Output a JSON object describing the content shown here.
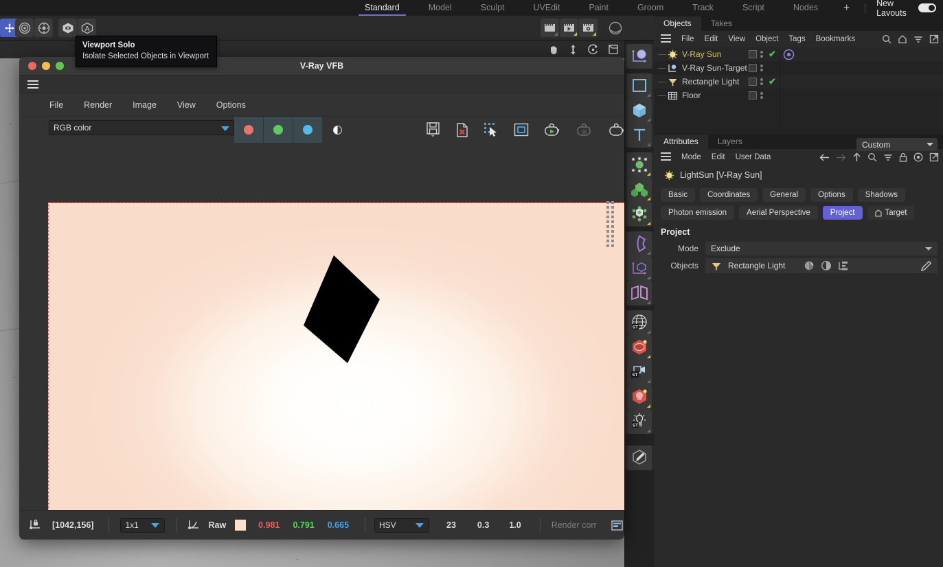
{
  "topbar": {
    "tabs": [
      {
        "label": "Standard",
        "active": true
      },
      {
        "label": "Model",
        "active": false
      },
      {
        "label": "Sculpt",
        "active": false
      },
      {
        "label": "UVEdit",
        "active": false
      },
      {
        "label": "Paint",
        "active": false
      },
      {
        "label": "Groom",
        "active": false
      },
      {
        "label": "Track",
        "active": false
      },
      {
        "label": "Script",
        "active": false
      },
      {
        "label": "Nodes",
        "active": false
      }
    ],
    "plus": "+",
    "new_layouts_label": "New Layouts",
    "toggle_on": true,
    "accent_color": "#6e6ee0"
  },
  "tooltip": {
    "title": "Viewport Solo",
    "body": "Isolate Selected Objects in Viewport"
  },
  "vfb": {
    "window_title": "V-Ray VFB",
    "menus": [
      "File",
      "Render",
      "Image",
      "View",
      "Options"
    ],
    "channel_select": {
      "value": "RGB color",
      "caret_color": "#4aa3dd"
    },
    "channel_buttons": [
      {
        "name": "red-channel",
        "color": "#e8736f"
      },
      {
        "name": "green-channel",
        "color": "#5ecb5e"
      },
      {
        "name": "blue-channel",
        "color": "#55b9ea"
      },
      {
        "name": "alpha-channel",
        "color": "#ffffff"
      }
    ],
    "toolbar_icons": [
      "save-image-icon",
      "remove-image-icon",
      "region-render-icon",
      "frame-stamp-icon",
      "render-start-icon",
      "render-stop-icon",
      "render-last-icon"
    ],
    "status": {
      "pixel_coords": "[1042,156]",
      "zoom_level": "1x1",
      "mode_label": "Raw",
      "swatch_color": "#fbe0cd",
      "r": "0.981",
      "g": "0.791",
      "b": "0.665",
      "r_color": "#e8605a",
      "g_color": "#4ddc5c",
      "b_color": "#4aa3e8",
      "color_space": "HSV",
      "h": "23",
      "s": "0.3",
      "v": "1.0",
      "render_text": "Render corr"
    }
  },
  "objects_panel": {
    "tabs": [
      {
        "label": "Objects",
        "active": true
      },
      {
        "label": "Takes",
        "active": false
      }
    ],
    "menu": [
      "File",
      "Edit",
      "View",
      "Object",
      "Tags",
      "Bookmarks"
    ],
    "menu_icons": [
      "search-icon",
      "home-icon",
      "filter-icon",
      "open-external-icon"
    ],
    "items": [
      {
        "label": "V-Ray Sun",
        "icon": "sun-light-icon",
        "selected": true,
        "has_check": true,
        "has_radio": true
      },
      {
        "label": "V-Ray Sun-Target",
        "icon": "target-null-icon",
        "selected": false,
        "has_check": false,
        "has_radio": false
      },
      {
        "label": "Rectangle Light",
        "icon": "rectangle-light-icon",
        "selected": false,
        "has_check": true,
        "has_radio": false
      },
      {
        "label": "Floor",
        "icon": "floor-plane-icon",
        "selected": false,
        "has_check": false,
        "has_radio": false
      }
    ]
  },
  "attributes_panel": {
    "tabs": [
      {
        "label": "Attributes",
        "active": true
      },
      {
        "label": "Layers",
        "active": false
      }
    ],
    "menu": [
      "Mode",
      "Edit",
      "User Data"
    ],
    "menu_icons": [
      "back-arrow-icon",
      "forward-arrow-icon",
      "up-arrow-icon",
      "search-icon",
      "filter-icon",
      "lock-icon",
      "record-icon",
      "open-external-icon"
    ],
    "object_title": "LightSun [V-Ray Sun]",
    "preset": "Custom",
    "chips_row1": [
      {
        "label": "Basic",
        "active": false
      },
      {
        "label": "Coordinates",
        "active": false
      },
      {
        "label": "General",
        "active": false
      },
      {
        "label": "Options",
        "active": false
      },
      {
        "label": "Shadows",
        "active": false
      }
    ],
    "chips_row2": [
      {
        "label": "Photon emission",
        "active": false
      },
      {
        "label": "Aerial Perspective",
        "active": false
      },
      {
        "label": "Project",
        "active": true
      },
      {
        "label": "Target",
        "active": false,
        "icon": "target-tag-icon"
      }
    ],
    "section_title": "Project",
    "mode_label": "Mode",
    "mode_value": "Exclude",
    "objects_label": "Objects",
    "objects_value": "Rectangle Light",
    "objects_icon": "rectangle-light-icon",
    "row_icons": [
      "shadow-toggle-icon",
      "contrast-toggle-icon",
      "hierarchy-toggle-icon"
    ],
    "edit_icon": "pencil-icon",
    "active_chip_color": "#6262d6"
  },
  "right_rail": {
    "groups": [
      {
        "items": [
          {
            "name": "axis-null-icon",
            "badge": "none"
          }
        ]
      },
      {
        "items": [
          {
            "name": "spline-rectangle-icon",
            "badge": "gray"
          },
          {
            "name": "cube-primitive-icon",
            "badge": "gray"
          },
          {
            "name": "text-spline-icon",
            "badge": "gray"
          }
        ]
      },
      {
        "items": [
          {
            "name": "deformer-icon",
            "badge": "yellow"
          },
          {
            "name": "array-generator-icon",
            "badge": "yellow"
          },
          {
            "name": "mograph-icon",
            "badge": "yellow"
          }
        ]
      },
      {
        "items": [
          {
            "name": "nurbs-loft-icon",
            "badge": "gray"
          },
          {
            "name": "axis-cube-icon",
            "badge": "gray"
          },
          {
            "name": "symmetry-icon",
            "badge": "gray"
          }
        ]
      },
      {
        "items": [
          {
            "name": "environment-sky-icon",
            "badge": "gray"
          },
          {
            "name": "vray-material-icon",
            "badge": "yellow"
          },
          {
            "name": "camera-icon",
            "badge": "gray"
          },
          {
            "name": "vray-light-icon",
            "badge": "yellow"
          },
          {
            "name": "light-setup-icon",
            "badge": "gray"
          }
        ]
      },
      {
        "items": [
          {
            "name": "edit-paint-icon",
            "badge": "none"
          }
        ]
      }
    ]
  },
  "viewport_toolbar": {
    "left_icons": [
      "move-tool-icon",
      "gear-tool-icon",
      "viewport-solo-icon",
      "annotation-icon"
    ],
    "right_icons": [
      "render-view-icon",
      "render-preview-icon",
      "render-settings-icon",
      "material-sphere-icon"
    ],
    "nav_icons": [
      "pan-icon",
      "dolly-icon",
      "orbit-icon",
      "frame-icon"
    ]
  },
  "render_image": {
    "description": "Rendered white-hot light with black rectangular blocker",
    "background_gradient_inner": "#ffffff",
    "background_gradient_outer": "#fadcca",
    "blocker_color": "#000000",
    "blocker_points": "457,288 524,352 477,445 413,390"
  }
}
